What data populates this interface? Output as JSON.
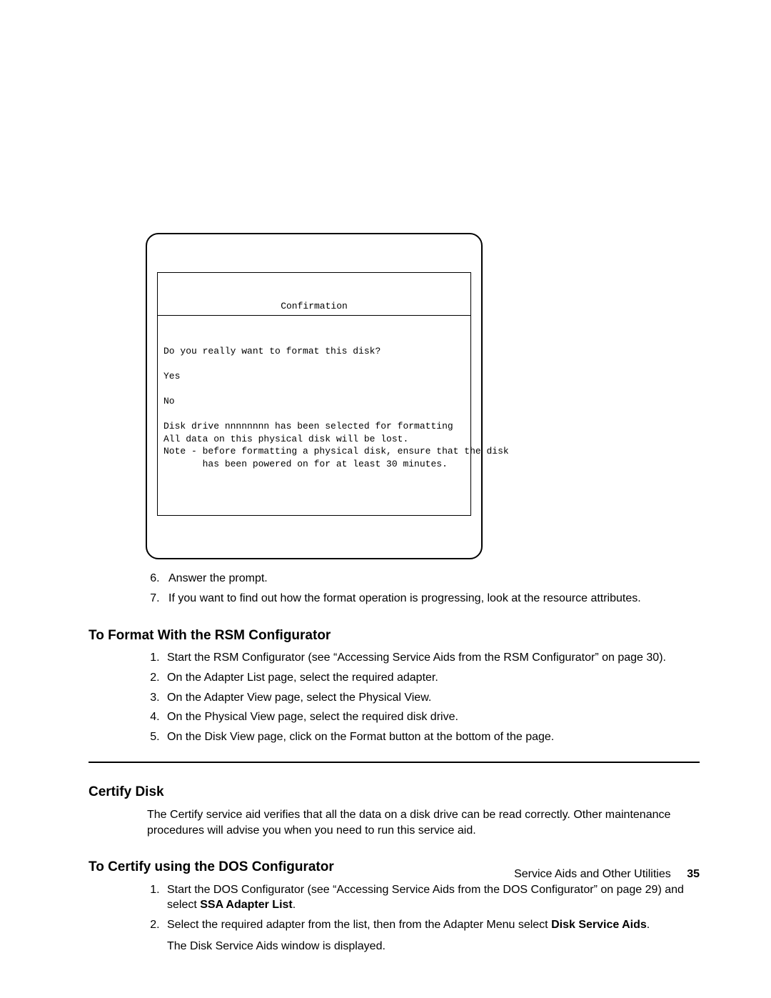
{
  "dialog": {
    "title": "Confirmation",
    "line1": "Do you really want to format this disk?",
    "yes": "Yes",
    "no": "No",
    "msg1": "Disk drive nnnnnnnn has been selected for formatting",
    "msg2": "All data on this physical disk will be lost.",
    "msg3": "Note - before formatting a physical disk, ensure that the disk",
    "msg4": "       has been powered on for at least 30 minutes."
  },
  "steps_a": {
    "s6": "Answer the prompt.",
    "s7": "If you want to find out how the format operation is progressing, look at the resource attributes."
  },
  "heading1": "To Format With the RSM Configurator",
  "rsm": {
    "s1a": "Start the RSM Configurator (see “Accessing Service Aids from the RSM Configurator” on page ",
    "s1_page": "30",
    "s1b": ").",
    "s2": "On the Adapter List page, select the required adapter.",
    "s3": "On the Adapter View page, select the Physical View.",
    "s4": "On the Physical View page, select the required disk drive.",
    "s5": "On the Disk View page, click on the Format button at the bottom of the page."
  },
  "heading2": "Certify Disk",
  "certify_intro": "The Certify service aid verifies that all the data on a disk drive can be read correctly. Other maintenance procedures will advise you when you need to run this service aid.",
  "heading3": "To Certify using the DOS Configurator",
  "dos": {
    "s1a": "Start the DOS Configurator (see “Accessing Service Aids from the DOS Configurator” on page ",
    "s1_page": "29",
    "s1b": ") and select ",
    "s1_bold": "SSA Adapter List",
    "s1c": ".",
    "s2a": "Select the required adapter from the list, then from the Adapter Menu select ",
    "s2_bold": "Disk Service Aids",
    "s2b": ".",
    "s2_after": "The Disk Service Aids window is displayed."
  },
  "footer": {
    "text": "Service Aids and Other Utilities",
    "page": "35"
  }
}
